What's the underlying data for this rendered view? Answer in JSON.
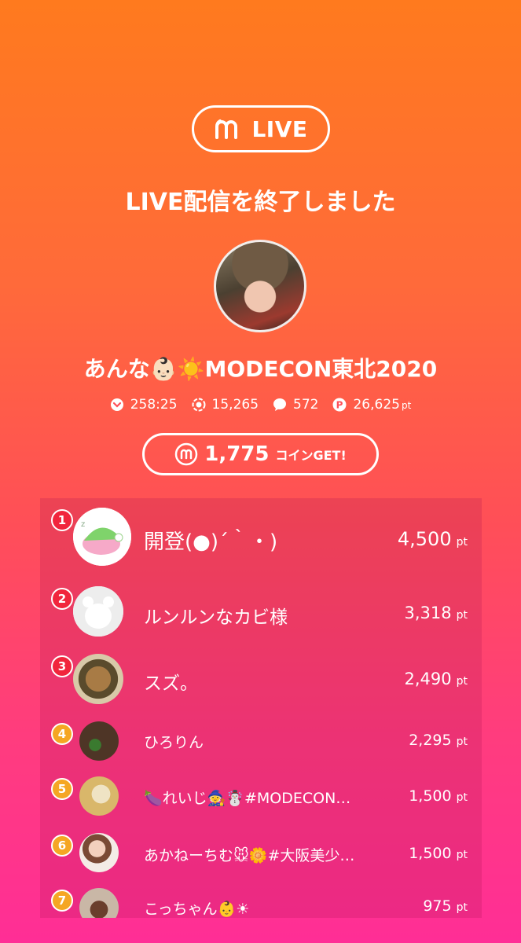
{
  "header": {
    "logo_text": "LIVE",
    "headline": "LIVE配信を終了しました"
  },
  "streamer": {
    "name": "あんな👶🏻☀️MODECON東北2020"
  },
  "stats": {
    "duration": "258:25",
    "viewers": "15,265",
    "comments": "572",
    "points": "26,625",
    "points_unit": "pt"
  },
  "coins": {
    "amount": "1,775",
    "label": "コインGET!"
  },
  "ranking": [
    {
      "rank": "1",
      "name": "開登(●)´｀・)",
      "points": "4,500",
      "unit": "pt"
    },
    {
      "rank": "2",
      "name": "ルンルンなカビ様",
      "points": "3,318",
      "unit": "pt"
    },
    {
      "rank": "3",
      "name": "スズ。",
      "points": "2,490",
      "unit": "pt"
    },
    {
      "rank": "4",
      "name": "ひろりん",
      "points": "2,295",
      "unit": "pt"
    },
    {
      "rank": "5",
      "name": "🍆れいじ🧙☃️#MODECON…",
      "points": "1,500",
      "unit": "pt"
    },
    {
      "rank": "6",
      "name": "あかねーちむ🐭🌼#大阪美少…",
      "points": "1,500",
      "unit": "pt"
    },
    {
      "rank": "7",
      "name": "こっちゃん👶☀",
      "points": "975",
      "unit": "pt"
    }
  ],
  "icons": {
    "logo": "m-logo-icon",
    "duration": "chevron-circle-icon",
    "viewers": "eye-ring-icon",
    "comments": "speech-bubble-icon",
    "points": "p-coin-icon",
    "coin": "m-coin-icon"
  },
  "colors": {
    "rank_top": "#F1253C",
    "rank_other": "#F5A623"
  }
}
